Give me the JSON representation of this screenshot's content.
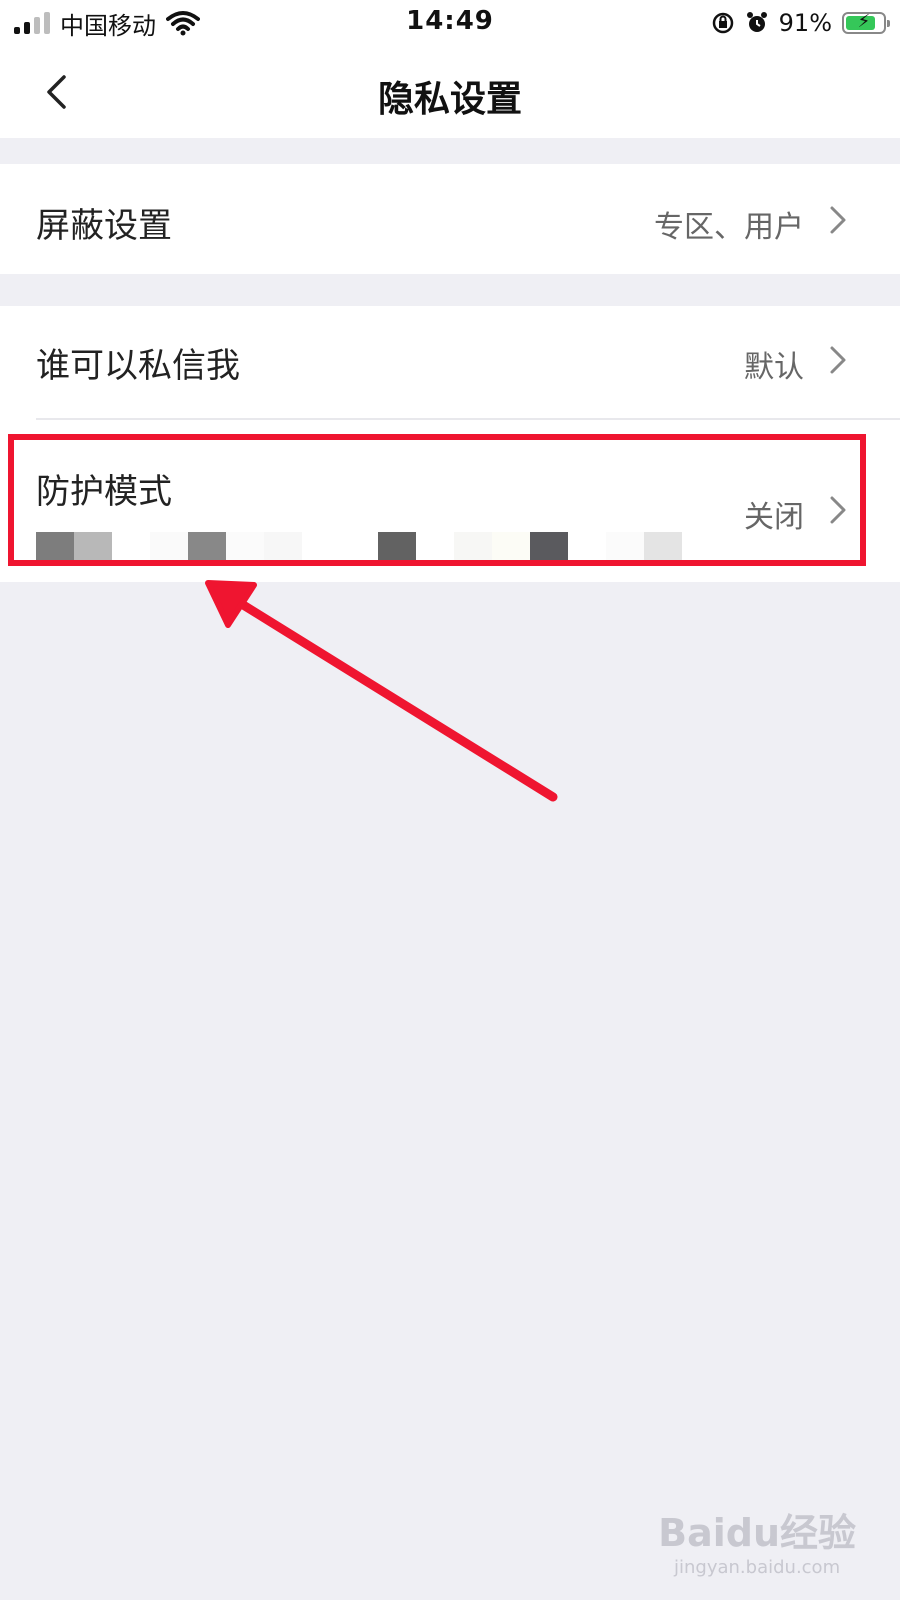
{
  "status_bar": {
    "carrier": "中国移动",
    "time": "14:49",
    "battery_percent": "91%",
    "battery_level": 0.91
  },
  "nav": {
    "title": "隐私设置"
  },
  "settings": [
    {
      "title": "屏蔽设置",
      "value": "专区、用户"
    },
    {
      "title": "谁可以私信我",
      "value": "默认"
    },
    {
      "title": "防护模式",
      "value": "关闭"
    }
  ],
  "colors": {
    "highlight": "#ef1530",
    "background": "#efeff4",
    "battery": "#35c759"
  },
  "icons": {
    "back": "chevron-left-icon",
    "row_arrow": "chevron-right-icon",
    "wifi": "wifi-icon",
    "alarm": "alarm-icon",
    "rotation_lock": "rotation-lock-icon"
  },
  "watermark": {
    "logo": "Baidu经验",
    "url": "jingyan.baidu.com"
  }
}
